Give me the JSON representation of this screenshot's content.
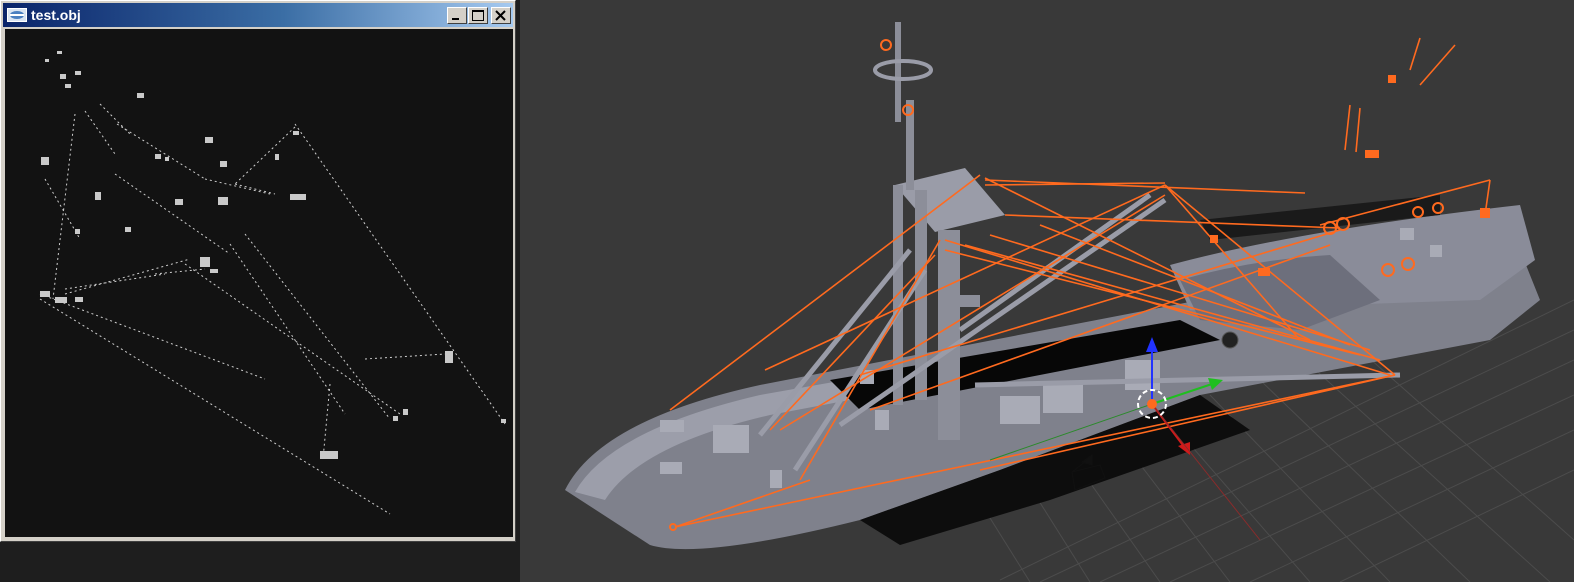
{
  "window": {
    "title": "test.obj",
    "icon": "app-window-icon",
    "buttons": [
      "minimize-icon",
      "maximize-icon",
      "close-icon"
    ]
  },
  "viewport": {
    "object": "fishing-boat-mesh",
    "selection_color": "#ff6a1f",
    "mesh_color": "#9c9eaa",
    "background": "#393939",
    "axis_colors": {
      "x": "#d11a1a",
      "y": "#1fbf1f",
      "z": "#2233ff"
    }
  }
}
